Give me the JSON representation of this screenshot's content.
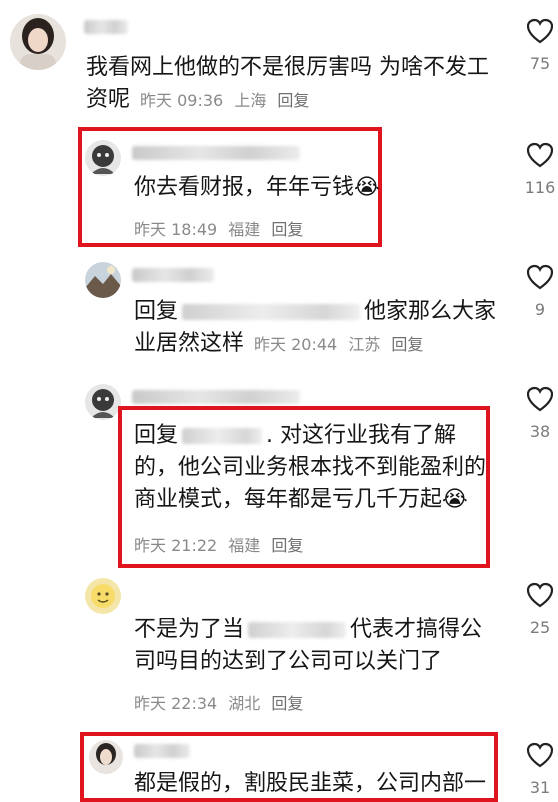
{
  "comments": [
    {
      "line1": "我看网上他做的不是很厉害吗 为啥不发工",
      "line2": "资呢",
      "time": "昨天 09:36",
      "location": "上海",
      "reply": "回复",
      "likes": "75"
    },
    {
      "line1": "你去看财报，年年亏钱",
      "emoji": "😭",
      "time": "昨天 18:49",
      "location": "福建",
      "reply": "回复",
      "likes": "116"
    },
    {
      "prefix": "回复",
      "line1_tail": "他家那么大家",
      "line2": "业居然这样",
      "time": "昨天 20:44",
      "location": "江苏",
      "reply": "回复",
      "likes": "9"
    },
    {
      "prefix": "回复",
      "line1_tail": ". 对这行业我有了解",
      "line2": "的，他公司业务根本找不到能盈利的",
      "line3": "商业模式，每年都是亏几千万起",
      "emoji": "😭",
      "time": "昨天 21:22",
      "location": "福建",
      "reply": "回复",
      "likes": "38"
    },
    {
      "line1_head": "不是为了当",
      "line1_tail": "代表才搞得公",
      "line2": "司吗目的达到了公司可以关门了",
      "time": "昨天 22:34",
      "location": "湖北",
      "reply": "回复",
      "likes": "25"
    },
    {
      "line1": "都是假的，割股民韭菜，公司内部一",
      "likes": "31"
    }
  ],
  "icons": {
    "like": "heart-outline-icon"
  },
  "colors": {
    "highlight": "#e0141f",
    "meta": "#8a8a8a"
  }
}
